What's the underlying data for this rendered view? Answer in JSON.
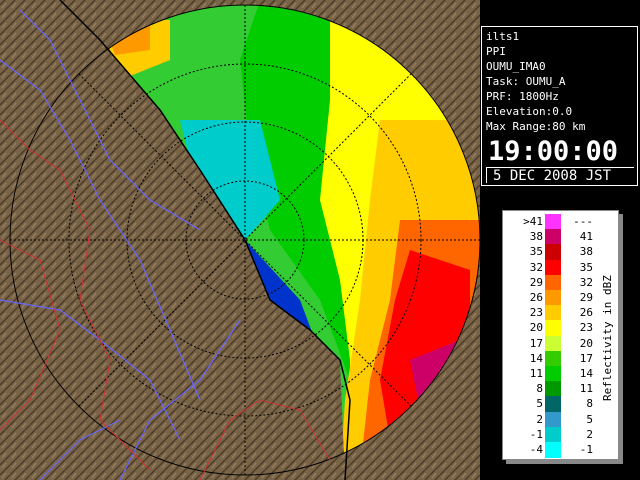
{
  "info": {
    "station": "ilts1",
    "mode": "PPI",
    "site": "OUMU_IMA0",
    "task": "Task: OUMU_A",
    "prf": "PRF: 1800Hz",
    "elevation": "Elevation:0.0",
    "max_range": "Max Range:80 km",
    "time": "19:00:00",
    "date": "5 DEC 2008 JST"
  },
  "legend": {
    "title": "Reflectivity in dBZ",
    "rows": [
      {
        "lo": ">41",
        "hi": "---",
        "color": "#ff33ff"
      },
      {
        "lo": "38",
        "hi": "41",
        "color": "#cc0066"
      },
      {
        "lo": "35",
        "hi": "38",
        "color": "#cc0000"
      },
      {
        "lo": "32",
        "hi": "35",
        "color": "#ff0000"
      },
      {
        "lo": "29",
        "hi": "32",
        "color": "#ff6600"
      },
      {
        "lo": "26",
        "hi": "29",
        "color": "#ff9900"
      },
      {
        "lo": "23",
        "hi": "26",
        "color": "#ffcc00"
      },
      {
        "lo": "20",
        "hi": "23",
        "color": "#ffff00"
      },
      {
        "lo": "17",
        "hi": "20",
        "color": "#ccff33"
      },
      {
        "lo": "14",
        "hi": "17",
        "color": "#33cc00"
      },
      {
        "lo": "11",
        "hi": "14",
        "color": "#00cc00"
      },
      {
        "lo": "8",
        "hi": "11",
        "color": "#009900"
      },
      {
        "lo": "5",
        "hi": "8",
        "color": "#006666"
      },
      {
        "lo": "2",
        "hi": "5",
        "color": "#3399cc"
      },
      {
        "lo": "-1",
        "hi": "2",
        "color": "#00cccc"
      },
      {
        "lo": "-4",
        "hi": "-1",
        "color": "#00ffff"
      }
    ]
  },
  "colors": {
    "land": "#7a6448",
    "sea": "#0033cc",
    "range_ring": "#000000",
    "river": "#6666ff",
    "border": "#cc3333"
  }
}
